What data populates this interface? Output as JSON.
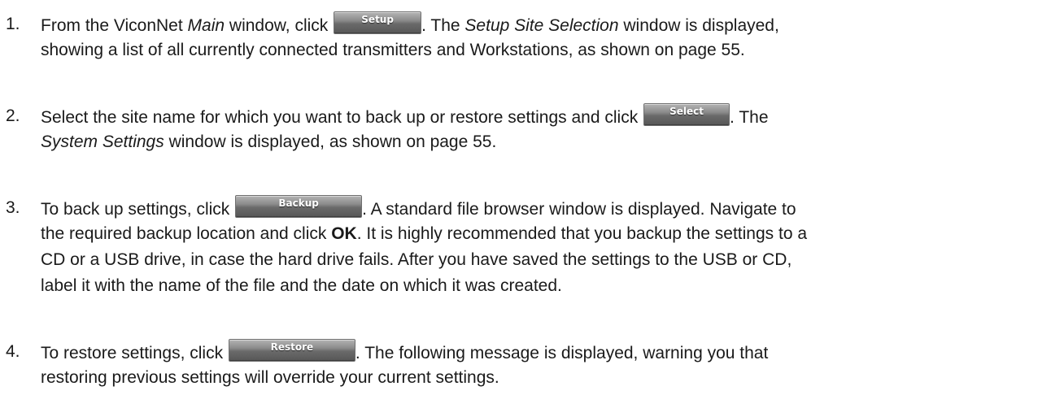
{
  "steps": [
    {
      "number": "1.",
      "l1_a": "From the ViconNet ",
      "l1_b": "Main",
      "l1_c": " window, click ",
      "button": "Setup",
      "l1_d": ". The ",
      "l1_e": "Setup Site Selection",
      "l1_f": " window is displayed,",
      "l2": "showing a list of all currently connected transmitters and Workstations, as shown on page 55."
    },
    {
      "number": "2.",
      "l1_a": "Select the site name for which you want to back up or restore settings and click ",
      "button": "Select",
      "l1_b": ". The",
      "l2_a": "System Settings",
      "l2_b": " window is displayed, as shown on page 55."
    },
    {
      "number": "3.",
      "l1_a": "To back up settings, click ",
      "button": "Backup",
      "l1_b": ". A standard file browser window is displayed. Navigate to",
      "l2_a": "the required backup location and click ",
      "l2_b": "OK",
      "l2_c": ". It is highly recommended that you backup the settings to a",
      "l3": "CD or a USB drive, in case the hard drive fails. After you have saved the settings to the USB or CD,",
      "l4": "label it with the name of the file and the date on which it was created."
    },
    {
      "number": "4.",
      "l1_a": "To restore settings, click ",
      "button": "Restore",
      "l1_b": ". The following message is displayed, warning you that",
      "l2": "restoring previous settings will override your current settings."
    }
  ]
}
